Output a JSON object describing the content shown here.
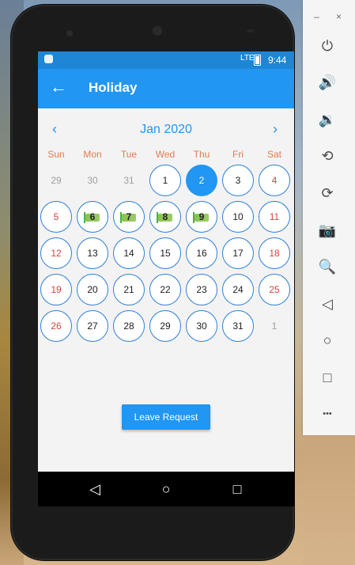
{
  "app": {
    "title": "Holiday",
    "back_icon": "arrow-left-icon",
    "accent_color": "#2196f3",
    "status_time": "9:44",
    "status_signal": "LTE"
  },
  "calendar": {
    "month": "Jan 2020",
    "prev_icon": "chevron-left-icon",
    "next_icon": "chevron-right-icon",
    "weekdays": [
      "Sun",
      "Mon",
      "Tue",
      "Wed",
      "Thu",
      "Fri",
      "Sat"
    ],
    "weeks": [
      [
        {
          "label": "29",
          "type": "muted"
        },
        {
          "label": "30",
          "type": "muted"
        },
        {
          "label": "31",
          "type": "muted"
        },
        {
          "label": "1",
          "type": "normal"
        },
        {
          "label": "2",
          "type": "today"
        },
        {
          "label": "3",
          "type": "normal"
        },
        {
          "label": "4",
          "type": "weekend"
        }
      ],
      [
        {
          "label": "5",
          "type": "weekend"
        },
        {
          "label": "6",
          "type": "holiday"
        },
        {
          "label": "7",
          "type": "holiday"
        },
        {
          "label": "8",
          "type": "holiday"
        },
        {
          "label": "9",
          "type": "holiday"
        },
        {
          "label": "10",
          "type": "normal"
        },
        {
          "label": "11",
          "type": "weekend"
        }
      ],
      [
        {
          "label": "12",
          "type": "weekend"
        },
        {
          "label": "13",
          "type": "normal"
        },
        {
          "label": "14",
          "type": "normal"
        },
        {
          "label": "15",
          "type": "normal"
        },
        {
          "label": "16",
          "type": "normal"
        },
        {
          "label": "17",
          "type": "normal"
        },
        {
          "label": "18",
          "type": "weekend"
        }
      ],
      [
        {
          "label": "19",
          "type": "weekend"
        },
        {
          "label": "20",
          "type": "normal"
        },
        {
          "label": "21",
          "type": "normal"
        },
        {
          "label": "22",
          "type": "normal"
        },
        {
          "label": "23",
          "type": "normal"
        },
        {
          "label": "24",
          "type": "normal"
        },
        {
          "label": "25",
          "type": "weekend"
        }
      ],
      [
        {
          "label": "26",
          "type": "weekend"
        },
        {
          "label": "27",
          "type": "normal"
        },
        {
          "label": "28",
          "type": "normal"
        },
        {
          "label": "29",
          "type": "normal"
        },
        {
          "label": "30",
          "type": "normal"
        },
        {
          "label": "31",
          "type": "normal"
        },
        {
          "label": "1",
          "type": "muted"
        }
      ]
    ],
    "holiday_icon": "holiday-flag-icon"
  },
  "actions": {
    "leave_request_label": "Leave Request"
  },
  "system_nav": {
    "back_icon": "nav-back-icon",
    "home_icon": "nav-home-icon",
    "recents_icon": "nav-recents-icon"
  },
  "emulator_panel": {
    "minimize_label": "–",
    "close_label": "×",
    "tools": [
      {
        "name": "power-icon",
        "glyph": "⏻"
      },
      {
        "name": "volume-up-icon",
        "glyph": "🔊"
      },
      {
        "name": "volume-down-icon",
        "glyph": "🔉"
      },
      {
        "name": "rotate-left-icon",
        "glyph": "⟲"
      },
      {
        "name": "rotate-right-icon",
        "glyph": "⟳"
      },
      {
        "name": "camera-icon",
        "glyph": "📷"
      },
      {
        "name": "zoom-icon",
        "glyph": "🔍"
      },
      {
        "name": "back-icon",
        "glyph": "◁"
      },
      {
        "name": "home-icon",
        "glyph": "○"
      },
      {
        "name": "overview-icon",
        "glyph": "□"
      },
      {
        "name": "more-icon",
        "glyph": "•••"
      }
    ]
  }
}
